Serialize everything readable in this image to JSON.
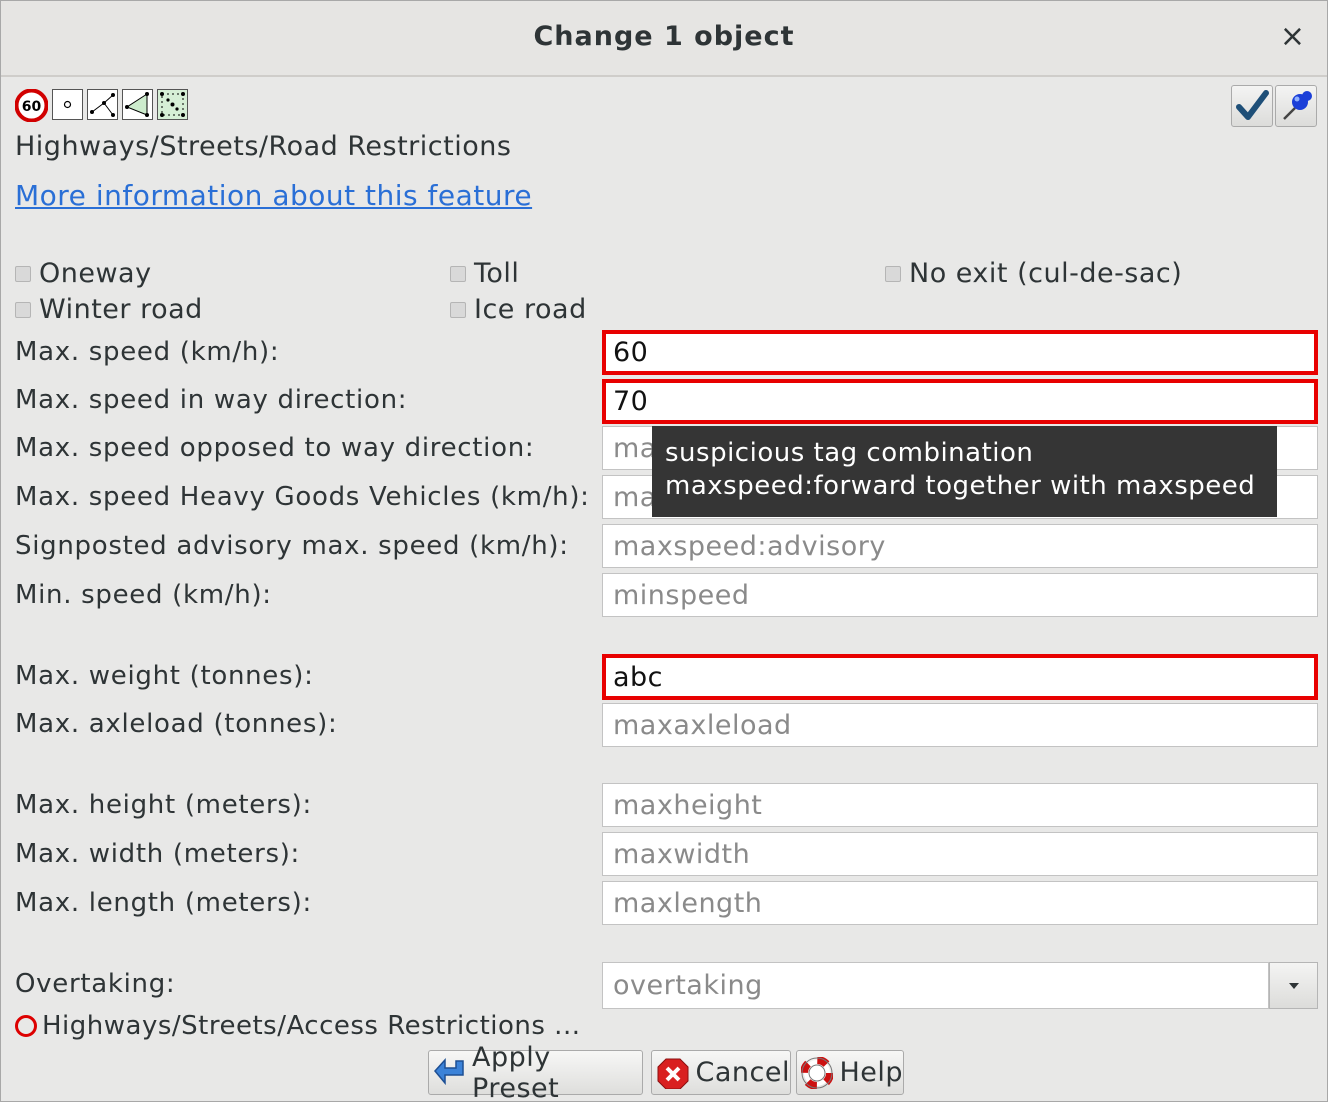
{
  "dialog": {
    "title": "Change 1 object",
    "close_glyph": "×"
  },
  "toolbar": {
    "icons": [
      "maxspeed-60-sign-icon",
      "node-icon",
      "way-icon",
      "closed-way-icon",
      "multipolygon-icon"
    ],
    "speed_sign_text": "60",
    "right_buttons": [
      "apply-check-icon",
      "pin-icon"
    ]
  },
  "preset": {
    "group": "Highways/Streets/Road Restrictions",
    "more_info_link": "More information about this feature"
  },
  "checkboxes": [
    {
      "label": "Oneway",
      "checked": false
    },
    {
      "label": "Toll",
      "checked": false
    },
    {
      "label": "No exit (cul-de-sac)",
      "checked": false
    },
    {
      "label": "Winter road",
      "checked": false
    },
    {
      "label": "Ice road",
      "checked": false
    }
  ],
  "fields": {
    "maxspeed": {
      "label": "Max. speed (km/h):",
      "value": "60",
      "placeholder": ""
    },
    "maxspeed_forward": {
      "label": "Max. speed in way direction:",
      "value": "70",
      "placeholder": ""
    },
    "maxspeed_backward": {
      "label": "Max. speed opposed to way direction:",
      "value": "",
      "placeholder": "ma"
    },
    "maxspeed_hgv": {
      "label": "Max. speed Heavy Goods Vehicles (km/h):",
      "value": "",
      "placeholder": "ma"
    },
    "maxspeed_advisory": {
      "label": "Signposted advisory max. speed (km/h):",
      "value": "",
      "placeholder": "maxspeed:advisory"
    },
    "minspeed": {
      "label": "Min. speed (km/h):",
      "value": "",
      "placeholder": "minspeed"
    },
    "maxweight": {
      "label": "Max. weight (tonnes):",
      "value": "abc",
      "placeholder": ""
    },
    "maxaxleload": {
      "label": "Max. axleload (tonnes):",
      "value": "",
      "placeholder": "maxaxleload"
    },
    "maxheight": {
      "label": "Max. height (meters):",
      "value": "",
      "placeholder": "maxheight"
    },
    "maxwidth": {
      "label": "Max. width (meters):",
      "value": "",
      "placeholder": "maxwidth"
    },
    "maxlength": {
      "label": "Max. length (meters):",
      "value": "",
      "placeholder": "maxlength"
    },
    "overtaking": {
      "label": "Overtaking:",
      "value": "",
      "placeholder": "overtaking"
    }
  },
  "tooltip": {
    "line1": "suspicious tag combination",
    "line2": "maxspeed:forward together with maxspeed"
  },
  "linked_preset": "Highways/Streets/Access Restrictions ...",
  "buttons": {
    "apply": "Apply Preset",
    "cancel": "Cancel",
    "help": "Help"
  },
  "colors": {
    "error_border": "#e80000",
    "link": "#2a6fd6",
    "tooltip_bg": "#353535"
  }
}
